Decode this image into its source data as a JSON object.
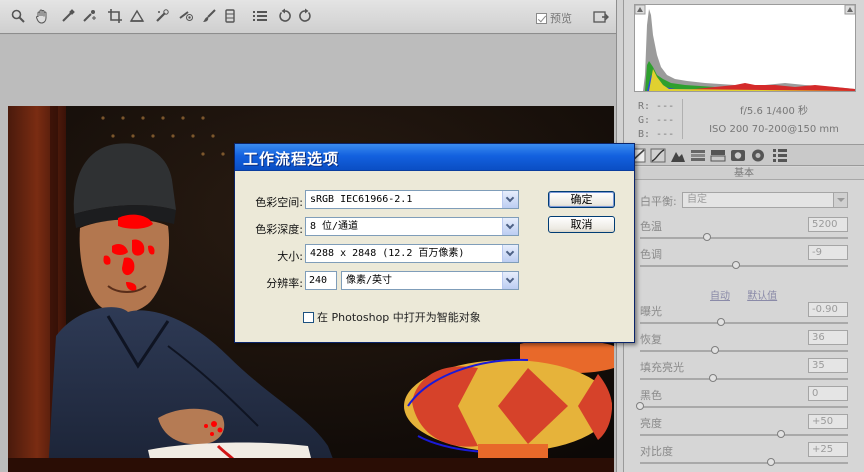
{
  "toolbar": {
    "tools": [
      {
        "name": "zoom-tool",
        "icon": "magnifier-icon"
      },
      {
        "name": "hand-tool",
        "icon": "hand-icon"
      },
      {
        "name": "white-balance-tool",
        "icon": "eyedropper-icon"
      },
      {
        "name": "color-sampler-tool",
        "icon": "sampler-icon"
      },
      {
        "name": "crop-tool",
        "icon": "crop-icon"
      },
      {
        "name": "straighten-tool",
        "icon": "straighten-icon"
      },
      {
        "name": "retouch-tool",
        "icon": "retouch-icon"
      },
      {
        "name": "red-eye-tool",
        "icon": "red-eye-icon"
      },
      {
        "name": "adjustment-brush-tool",
        "icon": "brush-icon"
      },
      {
        "name": "graduated-filter-tool",
        "icon": "gradient-icon"
      },
      {
        "name": "preferences-tool",
        "icon": "list-icon"
      },
      {
        "name": "rotate-ccw-tool",
        "icon": "rotate-left-icon"
      },
      {
        "name": "rotate-cw-tool",
        "icon": "rotate-right-icon"
      }
    ],
    "preview_label": "预览",
    "preview_checked": true
  },
  "readout": {
    "r": "R: ---",
    "g": "G: ---",
    "b": "B: ---",
    "camera_line1": "f/5.6  1/400 秒",
    "camera_line2": "ISO 200  70-200@150 mm"
  },
  "panel": {
    "header": "基本",
    "white_balance_label": "白平衡:",
    "white_balance_value": "自定",
    "auto_label": "自动",
    "default_label": "默认值",
    "adjustments": [
      {
        "label": "色温",
        "value": "5200",
        "level": 0.32
      },
      {
        "label": "色调",
        "value": "-9",
        "level": 0.46
      },
      {
        "label": "曝光",
        "value": "-0.90",
        "level": 0.39
      },
      {
        "label": "恢复",
        "value": "36",
        "level": 0.36
      },
      {
        "label": "填充亮光",
        "value": "35",
        "level": 0.35
      },
      {
        "label": "黑色",
        "value": "0",
        "level": 0.0
      },
      {
        "label": "亮度",
        "value": "+50",
        "level": 0.68
      },
      {
        "label": "对比度",
        "value": "+25",
        "level": 0.63
      }
    ]
  },
  "dialog": {
    "title": "工作流程选项",
    "color_space_label": "色彩空间:",
    "color_space_value": "sRGB IEC61966-2.1",
    "bit_depth_label": "色彩深度:",
    "bit_depth_value": "8 位/通道",
    "size_label": "大小:",
    "size_value": "4288 x 2848  (12.2 百万像素)",
    "resolution_label": "分辨率:",
    "resolution_value": "240",
    "resolution_unit": "像素/英寸",
    "ok_label": "确定",
    "cancel_label": "取消",
    "smart_object_label": "在 Photoshop 中打开为智能对象",
    "smart_object_checked": false
  },
  "colors": {
    "dialog_title_bar": "#1361df",
    "dialog_bg": "#ece9d8",
    "panel_bg": "#d6d6d6",
    "clipping_overlay": "#ff0000"
  }
}
